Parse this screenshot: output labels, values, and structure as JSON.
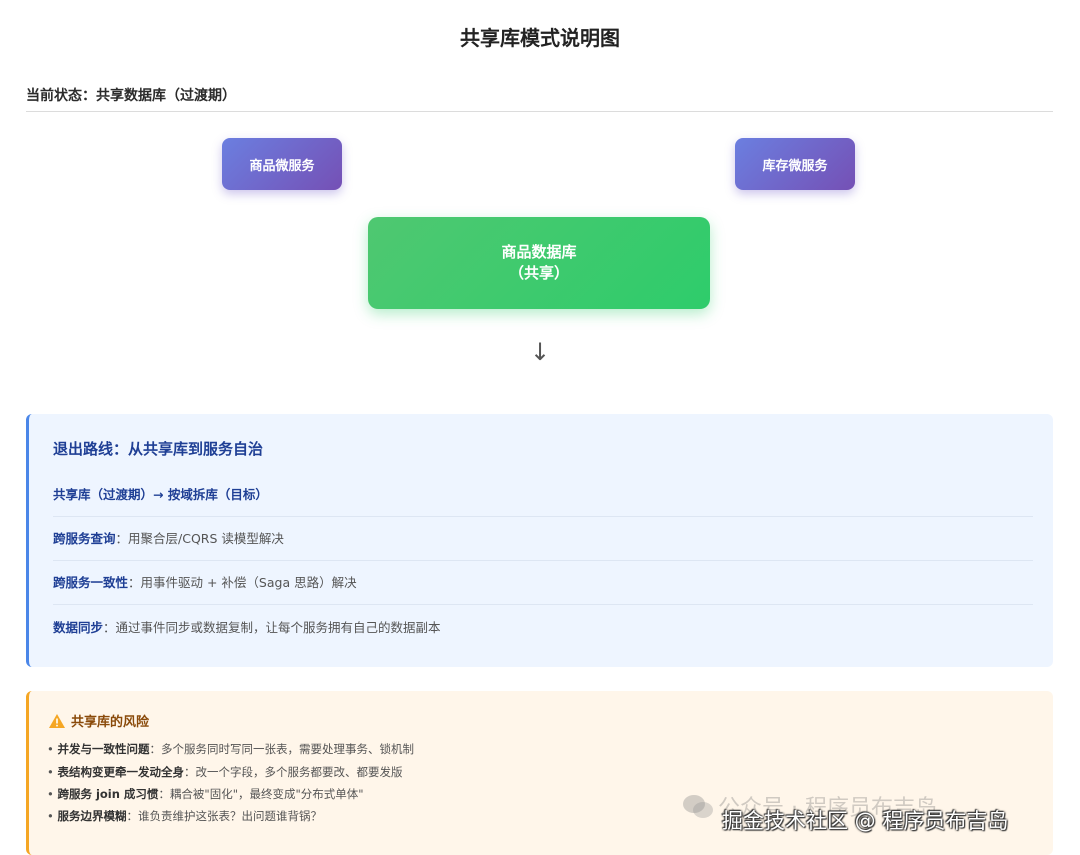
{
  "title": "共享库模式说明图",
  "state_heading": "当前状态：共享数据库（过渡期）",
  "services": {
    "left": "商品微服务",
    "right": "库存微服务"
  },
  "database": {
    "line1": "商品数据库",
    "line2": "（共享）"
  },
  "arrow": "↓",
  "exit": {
    "title": "退出路线：从共享库到服务自治",
    "rows": [
      {
        "key": "共享库（过渡期）→ 按域拆库（目标）",
        "value": ""
      },
      {
        "key": "跨服务查询",
        "value": "：用聚合层/CQRS 读模型解决"
      },
      {
        "key": "跨服务一致性",
        "value": "：用事件驱动 + 补偿（Saga 思路）解决"
      },
      {
        "key": "数据同步",
        "value": "：通过事件同步或数据复制，让每个服务拥有自己的数据副本"
      }
    ]
  },
  "risks": {
    "title": "共享库的风险",
    "items": [
      {
        "key": "并发与一致性问题",
        "value": "：多个服务同时写同一张表，需要处理事务、锁机制"
      },
      {
        "key": "表结构变更牵一发动全身",
        "value": "：改一个字段，多个服务都要改、都要发版"
      },
      {
        "key": "跨服务 join 成习惯",
        "value": "：耦合被\"固化\"，最终变成\"分布式单体\""
      },
      {
        "key": "服务边界模糊",
        "value": "：谁负责维护这张表？出问题谁背锅？"
      }
    ]
  },
  "watermark": {
    "faint": "公众号 · 程序员布吉岛",
    "main": "掘金技术社区 @ 程序员布吉岛"
  },
  "colors": {
    "service_gradient": [
      "#6b7fe0",
      "#7550b5"
    ],
    "db_gradient": [
      "#4fc871",
      "#2ecc6b"
    ],
    "exit_accent": "#4a86e8",
    "risk_accent": "#f5a623"
  }
}
